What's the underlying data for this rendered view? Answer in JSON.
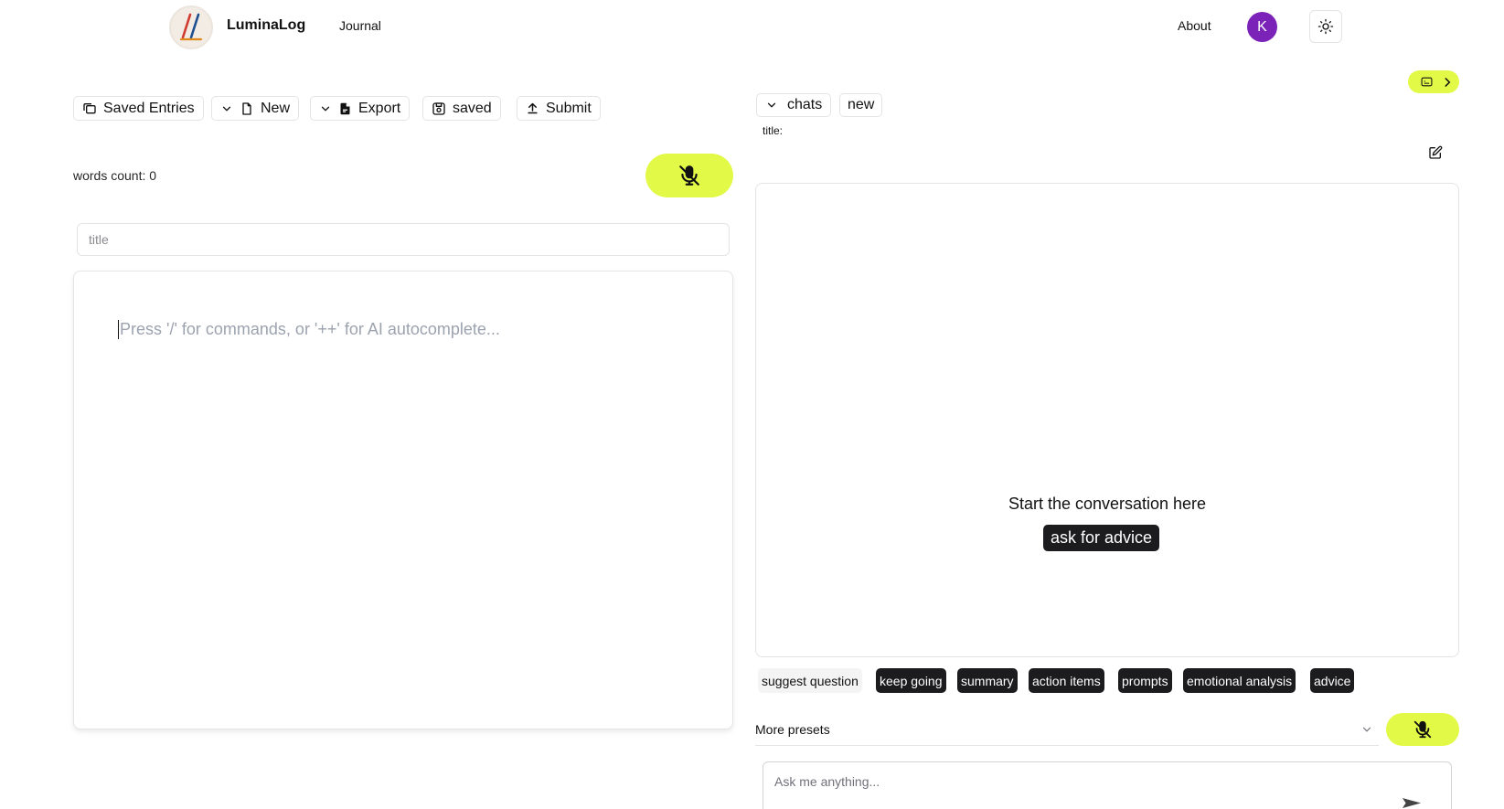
{
  "header": {
    "brand": "LuminaLog",
    "nav_journal": "Journal",
    "nav_about": "About",
    "avatar_initial": "K"
  },
  "toolbar": {
    "saved_entries": "Saved Entries",
    "new": "New",
    "export": "Export",
    "saved": "saved",
    "submit": "Submit"
  },
  "editor": {
    "words_count": "words count: 0",
    "title_placeholder": "title",
    "body_placeholder": "Press '/' for commands, or '++' for AI autocomplete..."
  },
  "chat": {
    "chats_label": "chats",
    "new_label": "new",
    "title_label": "title:",
    "start_text": "Start the conversation here",
    "advice_pill": "ask for advice",
    "chips": {
      "suggest": "suggest question",
      "keep_going": "keep going",
      "summary": "summary",
      "action_items": "action items",
      "prompts": "prompts",
      "emotional": "emotional analysis",
      "advice": "advice"
    },
    "more_presets": "More presets",
    "input_placeholder": "Ask me anything..."
  },
  "colors": {
    "accent": "#e2f947",
    "avatar": "#7b22b8",
    "chip_dark": "#1c1c1e"
  },
  "icons": [
    "logo-icon",
    "sun-icon",
    "files-icon",
    "chevron-down-icon",
    "file-icon",
    "file-export-icon",
    "floppy-icon",
    "upload-icon",
    "mic-off-icon",
    "panel-icon",
    "chevron-right-icon",
    "edit-icon",
    "send-icon"
  ]
}
